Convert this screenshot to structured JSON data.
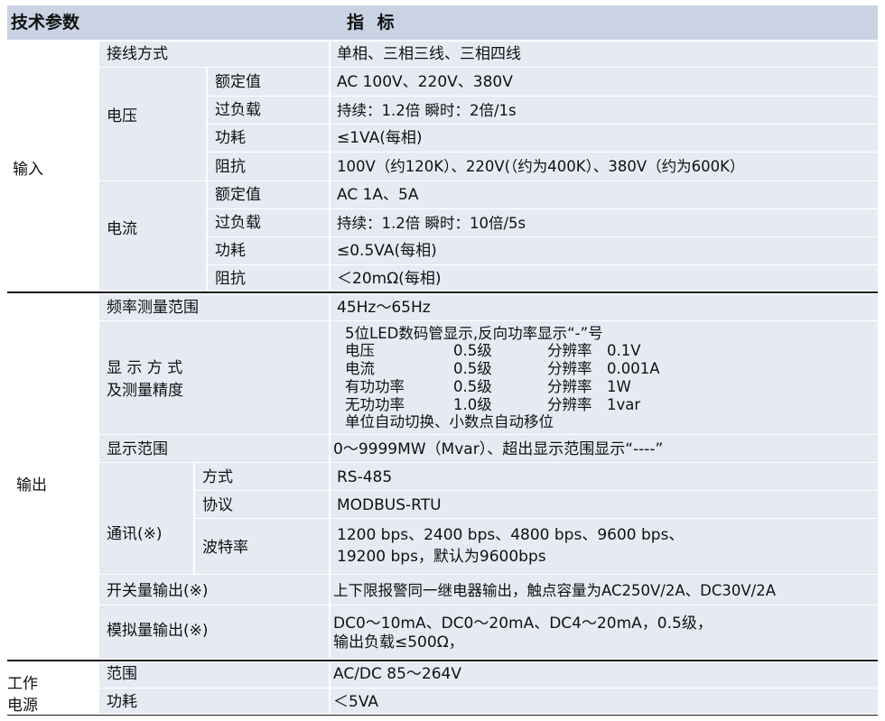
{
  "header": {
    "col1": "技术参数",
    "col2": "指  标"
  },
  "input": {
    "group": "输入",
    "wiring": {
      "label": "接线方式",
      "value": "单相、三相三线、三相四线"
    },
    "voltage": {
      "label": "电压",
      "rated": {
        "label": "额定值",
        "value": "AC  100V、220V、380V"
      },
      "overload": {
        "label": "过负载",
        "value": "持续：1.2倍  瞬时：2倍/1s"
      },
      "power": {
        "label": "功耗",
        "value": "≤1VA(每相)"
      },
      "impedance": {
        "label": "阻抗",
        "value": "100V（约120K）、220V(（约为400K）、380V（约为600K）"
      }
    },
    "current": {
      "label": "电流",
      "rated": {
        "label": "额定值",
        "value": "AC 1A、5A"
      },
      "overload": {
        "label": "过负载",
        "value": "持续：1.2倍  瞬时：10倍/5s"
      },
      "power": {
        "label": "功耗",
        "value": "≤0.5VA(每相)"
      },
      "impedance": {
        "label": "阻抗",
        "value": "＜20mΩ(每相)"
      }
    }
  },
  "output": {
    "group": "输出",
    "freq": {
      "label": "频率测量范围",
      "value": "45Hz～65Hz"
    },
    "display": {
      "label_line1": "显 示 方 式",
      "label_line2": "及测量精度",
      "intro": "5位LED数码管显示,反向功率显示“-”号",
      "rows": [
        {
          "name": "电压",
          "grade": "0.5级",
          "res_label": "分辨率",
          "res": "0.1V"
        },
        {
          "name": "电流",
          "grade": "0.5级",
          "res_label": "分辨率",
          "res": "0.001A"
        },
        {
          "name": "有功功率",
          "grade": "0.5级",
          "res_label": "分辨率",
          "res": "1W"
        },
        {
          "name": "无功功率",
          "grade": "1.0级",
          "res_label": "分辨率",
          "res": "1var"
        }
      ],
      "outro": "单位自动切换、小数点自动移位"
    },
    "range": {
      "label": "显示范围",
      "value": "0～9999MW（Mvar）、超出显示范围显示“----”"
    },
    "comm": {
      "label": "通讯(※)",
      "mode": {
        "label": "方式",
        "value": "RS-485"
      },
      "protocol": {
        "label": "协议",
        "value": "MODBUS-RTU"
      },
      "baud": {
        "label": "波特率",
        "value_line1": "1200 bps、2400 bps、4800 bps、9600 bps、",
        "value_line2": "19200 bps，默认为9600bps"
      }
    },
    "switch": {
      "label": "开关量输出(※)",
      "value": "上下限报警同一继电器输出，触点容量为AC250V/2A、DC30V/2A"
    },
    "analog": {
      "label": "模拟量输出(※)",
      "value_line1": "DC0～10mA、DC0～20mA、DC4～20mA，0.5级，",
      "value_line2": "输出负载≤500Ω，"
    }
  },
  "power_supply": {
    "group_line1": "工作",
    "group_line2": "电源",
    "range": {
      "label": "范围",
      "value": "AC/DC 85～264V"
    },
    "power": {
      "label": "功耗",
      "value": "＜5VA"
    }
  },
  "colors": {
    "header_bg": "#c9d3e3",
    "row_bg": "#e6ebf3",
    "rule": "#1a1a1a"
  }
}
